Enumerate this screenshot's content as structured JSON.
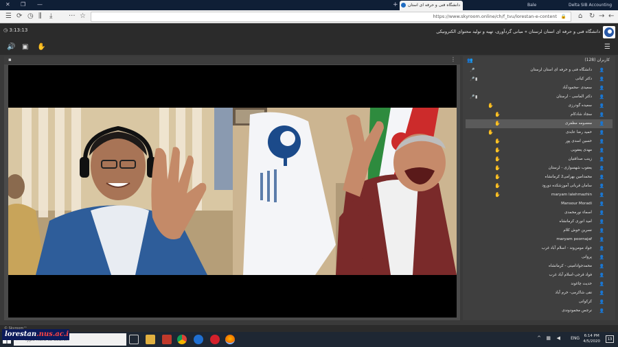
{
  "browser": {
    "tabs": [
      {
        "label": "دانشگاه فنی و حرفه ای استان",
        "active": true
      },
      {
        "label": "Bale",
        "active": false
      },
      {
        "label": "Delta SIB Accounting",
        "active": false
      }
    ],
    "url": "https://www.skyroom.online/ch/f_tvu/lorestan-e-content"
  },
  "app": {
    "timer": "3:13:13",
    "title": "دانشگاه فنی و حرفه ای استان لرستان » مبانی گردآوری، تهیه و تولید محتوای الکترونیکی"
  },
  "users": {
    "header_count": "کاربران (128)",
    "list": [
      {
        "name": "دانشگاه فنی و حرفه ای استان لرستان",
        "type": "blue",
        "mic": true,
        "cam": false,
        "hand": false,
        "sel": false
      },
      {
        "name": "دکتر کیانی",
        "type": "blue",
        "mic": true,
        "cam": true,
        "hand": false,
        "sel": false
      },
      {
        "name": "سعیدی -محمودآباد",
        "type": "blue",
        "mic": false,
        "cam": false,
        "hand": false,
        "sel": false
      },
      {
        "name": "دکتر الماسی - لرستان",
        "type": "blue",
        "mic": true,
        "cam": true,
        "hand": false,
        "sel": false
      },
      {
        "name": "سعیده گودرزی",
        "type": "gold",
        "mic": false,
        "cam": false,
        "hand": true,
        "handpos": "far",
        "sel": false
      },
      {
        "name": "سجاد شادکام",
        "type": "gold",
        "mic": false,
        "cam": false,
        "hand": true,
        "handpos": "near",
        "sel": false
      },
      {
        "name": "معصومه مظفری",
        "type": "gold",
        "mic": false,
        "cam": false,
        "hand": true,
        "handpos": "near",
        "sel": true
      },
      {
        "name": "حمید رضا عابدی",
        "type": "gold",
        "mic": false,
        "cam": false,
        "hand": true,
        "handpos": "far",
        "sel": false
      },
      {
        "name": "حسین اسدی پور",
        "type": "gold",
        "mic": false,
        "cam": false,
        "hand": true,
        "handpos": "near",
        "sel": false
      },
      {
        "name": "مهدی یعقوبی",
        "type": "gold",
        "mic": false,
        "cam": false,
        "hand": true,
        "handpos": "near",
        "sel": false
      },
      {
        "name": "زینب صداقتیان",
        "type": "gold",
        "mic": false,
        "cam": false,
        "hand": true,
        "handpos": "near",
        "sel": false
      },
      {
        "name": "یعقوب شهسواری - لرستان",
        "type": "gold",
        "mic": false,
        "cam": false,
        "hand": true,
        "handpos": "near",
        "sel": false
      },
      {
        "name": "محمدامین بهرامی2 کرمانشاه",
        "type": "gold",
        "mic": false,
        "cam": false,
        "hand": true,
        "handpos": "near",
        "sel": false
      },
      {
        "name": "سامان قربانی آموزشکده دورود",
        "type": "gold",
        "mic": false,
        "cam": false,
        "hand": true,
        "handpos": "near",
        "sel": false
      },
      {
        "name": "maryam lalehmazhin",
        "type": "gold",
        "mic": false,
        "cam": false,
        "hand": true,
        "handpos": "near",
        "sel": false
      },
      {
        "name": "Mansour Moradi",
        "type": "gray",
        "mic": false,
        "cam": false,
        "hand": false,
        "sel": false
      },
      {
        "name": "اسماء نورمحمدی",
        "type": "gold",
        "mic": false,
        "cam": false,
        "hand": false,
        "sel": false
      },
      {
        "name": "امید انوری کرمانشاه",
        "type": "gold",
        "mic": false,
        "cam": false,
        "hand": false,
        "sel": false
      },
      {
        "name": "نسرین خوش کلام",
        "type": "gold",
        "mic": false,
        "cam": false,
        "hand": false,
        "sel": false
      },
      {
        "name": "maryam poornajaf",
        "type": "gold",
        "mic": false,
        "cam": false,
        "hand": false,
        "sel": false
      },
      {
        "name": "جواد مومن‌وند - اسلام آباد غرب",
        "type": "gold",
        "mic": false,
        "cam": false,
        "hand": false,
        "sel": false
      },
      {
        "name": "پروانی",
        "type": "gold",
        "mic": false,
        "cam": false,
        "hand": false,
        "sel": false
      },
      {
        "name": "محمدجواد‌امینی - کرمانشاه",
        "type": "gold",
        "mic": false,
        "cam": false,
        "hand": false,
        "sel": false
      },
      {
        "name": "فواد قرجی-اسلام آباد غرب",
        "type": "gold",
        "mic": false,
        "cam": false,
        "hand": false,
        "sel": false
      },
      {
        "name": "حدیث چاغوند",
        "type": "gold",
        "mic": false,
        "cam": false,
        "hand": false,
        "sel": false
      },
      {
        "name": "نقی شاکرمی- خرم آباد",
        "type": "gold",
        "mic": false,
        "cam": false,
        "hand": false,
        "sel": false
      },
      {
        "name": "کرکوانی",
        "type": "gold",
        "mic": false,
        "cam": false,
        "hand": false,
        "sel": false
      },
      {
        "name": "نرجس محمودوندی",
        "type": "gold",
        "mic": false,
        "cam": false,
        "hand": false,
        "sel": false
      }
    ]
  },
  "footer": {
    "watermark": "© Skyroom™"
  },
  "taskbar": {
    "search_placeholder": "Type here to search",
    "lang": "ENG",
    "time": "6:14 PM",
    "date": "4/5/2020",
    "notif_count": "13"
  },
  "brand": {
    "prefix": "lorestan",
    "domain": ".nus.ac.ir"
  }
}
